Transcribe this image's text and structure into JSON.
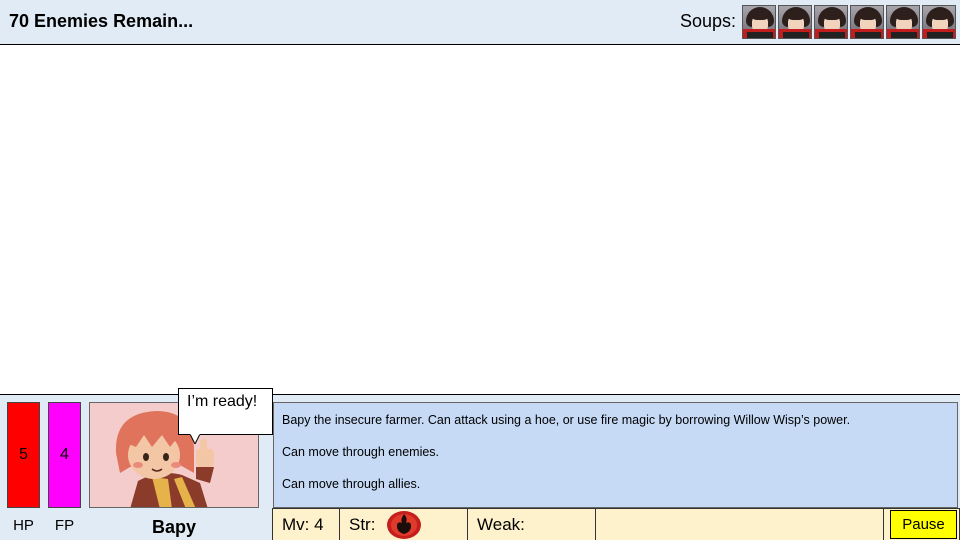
{
  "header": {
    "enemies_remaining": "70 Enemies Remain...",
    "soups_label": "Soups:",
    "soups": [
      {
        "icon": "soup-portrait-icon"
      },
      {
        "icon": "soup-portrait-icon"
      },
      {
        "icon": "soup-portrait-icon"
      },
      {
        "icon": "soup-portrait-icon"
      },
      {
        "icon": "soup-portrait-icon"
      },
      {
        "icon": "soup-portrait-icon"
      }
    ]
  },
  "unit": {
    "hp_value": "5",
    "hp_label": "HP",
    "fp_value": "4",
    "fp_label": "FP",
    "name": "Bapy",
    "speech": "I’m ready!",
    "description": [
      "Bapy the insecure farmer. Can attack using a hoe, or use fire magic by borrowing Willow Wisp’s power.",
      "Can move through enemies.",
      "Can move through allies."
    ],
    "move_label": "Mv: 4",
    "strength_label": "Str:",
    "strength_icon": "fire-element-icon",
    "weakness_label": "Weak:"
  },
  "controls": {
    "pause_label": "Pause"
  },
  "colors": {
    "hp": "#ff0000",
    "fp": "#ff00ff",
    "panel": "#e1ebf6",
    "description_bg": "#c6d9f5",
    "stats_bg": "#fef2cc",
    "pause_bg": "#ffff00"
  }
}
